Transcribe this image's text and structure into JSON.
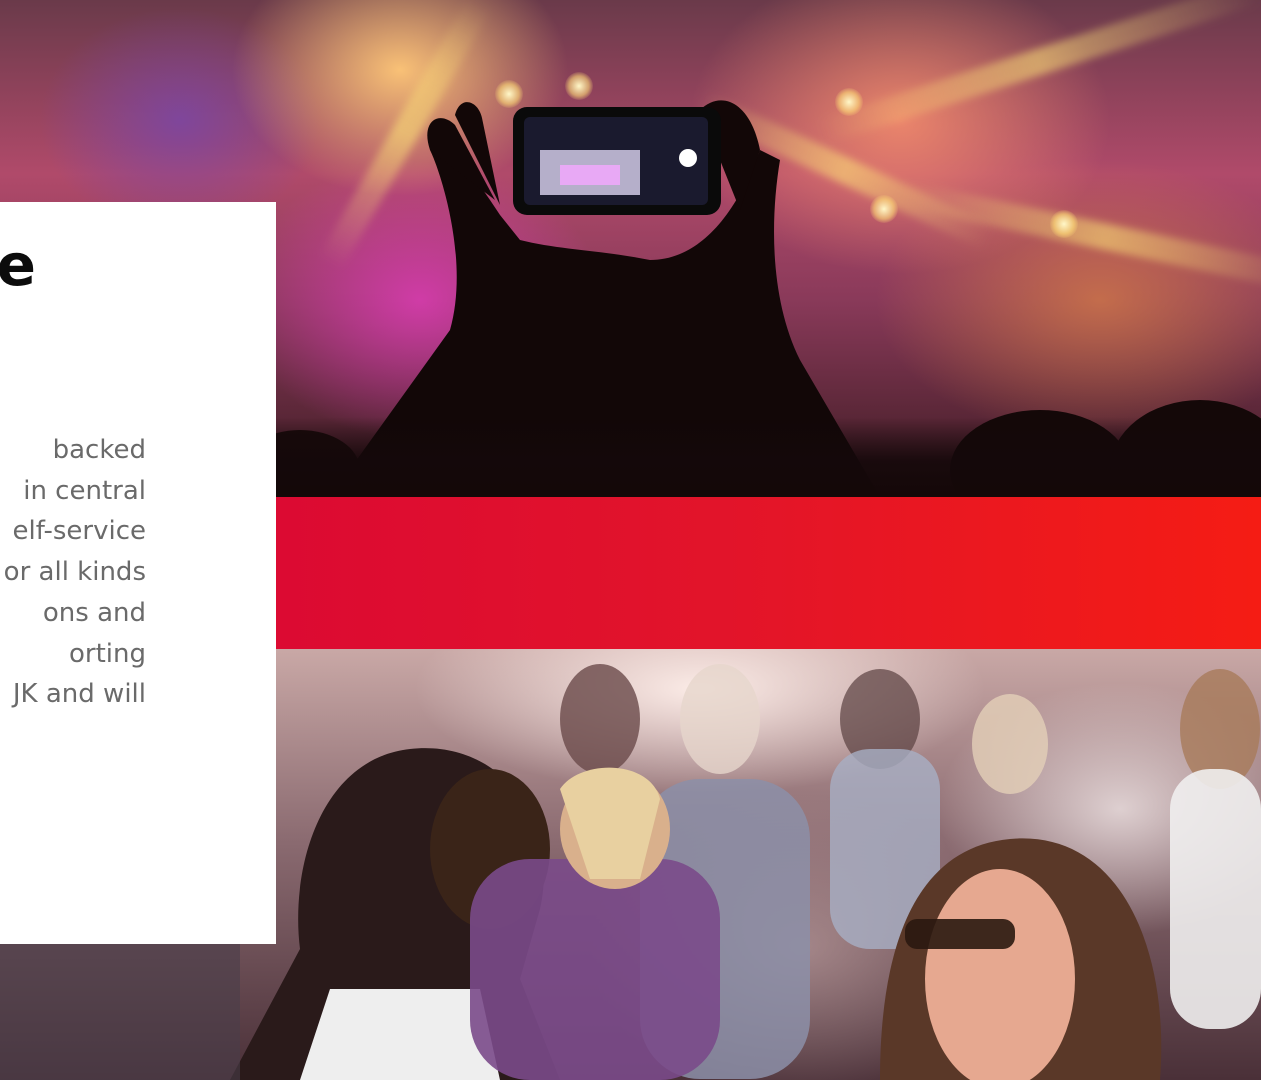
{
  "card": {
    "title": "e",
    "body_lines": [
      "backed",
      "in central",
      "elf-service",
      "or all kinds",
      "ons and",
      "orting",
      "JK and will"
    ]
  },
  "colors": {
    "band_start": "#dc0a32",
    "band_end": "#f51c14",
    "card_bg": "#ffffff",
    "title_text": "#0c0c0c",
    "body_text": "#6a6a6a"
  },
  "images": {
    "top": "concert-crowd-phone-photo",
    "bottom": "festival-crowd-photo"
  }
}
